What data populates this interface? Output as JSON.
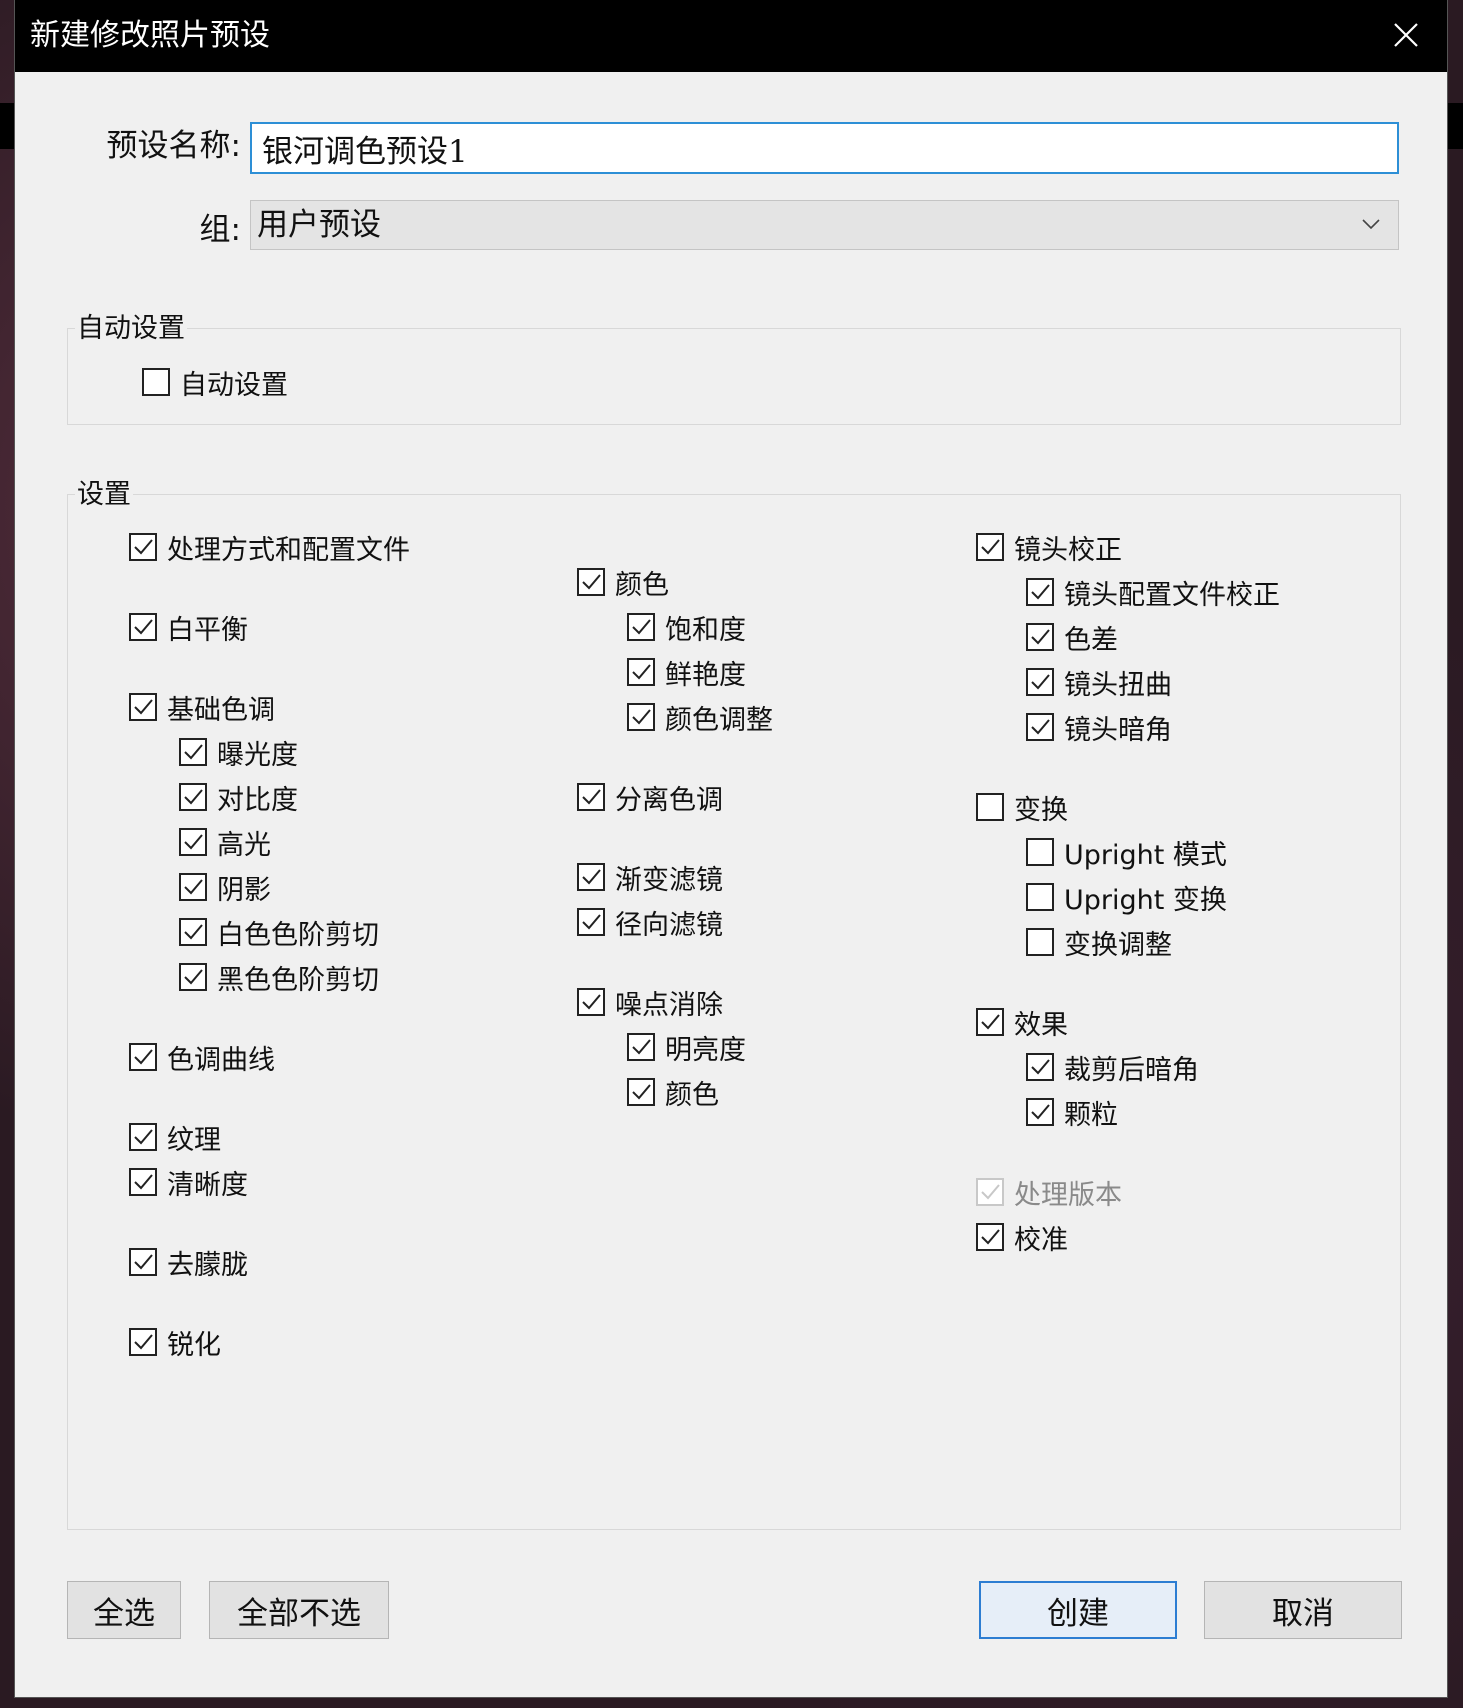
{
  "dialog": {
    "title": "新建修改照片预设",
    "close_icon": "close-icon"
  },
  "form": {
    "name_label": "预设名称:",
    "name_value": "银河调色预设1",
    "group_label": "组:",
    "group_value": "用户预设"
  },
  "auto_section": {
    "title": "自动设置",
    "items": [
      {
        "label": "自动设置",
        "checked": false
      }
    ]
  },
  "settings_section": {
    "title": "设置",
    "col1": [
      {
        "label": "处理方式和配置文件",
        "checked": true
      },
      {
        "label": "白平衡",
        "checked": true
      },
      {
        "label": "基础色调",
        "checked": true
      },
      {
        "label": "曝光度",
        "checked": true
      },
      {
        "label": "对比度",
        "checked": true
      },
      {
        "label": "高光",
        "checked": true
      },
      {
        "label": "阴影",
        "checked": true
      },
      {
        "label": "白色色阶剪切",
        "checked": true
      },
      {
        "label": "黑色色阶剪切",
        "checked": true
      },
      {
        "label": "色调曲线",
        "checked": true
      },
      {
        "label": "纹理",
        "checked": true
      },
      {
        "label": "清晰度",
        "checked": true
      },
      {
        "label": "去朦胧",
        "checked": true
      },
      {
        "label": "锐化",
        "checked": true
      }
    ],
    "col2": [
      {
        "label": "颜色",
        "checked": true
      },
      {
        "label": "饱和度",
        "checked": true
      },
      {
        "label": "鲜艳度",
        "checked": true
      },
      {
        "label": "颜色调整",
        "checked": true
      },
      {
        "label": "分离色调",
        "checked": true
      },
      {
        "label": "渐变滤镜",
        "checked": true
      },
      {
        "label": "径向滤镜",
        "checked": true
      },
      {
        "label": "噪点消除",
        "checked": true
      },
      {
        "label": "明亮度",
        "checked": true
      },
      {
        "label": "颜色",
        "checked": true
      }
    ],
    "col3": [
      {
        "label": "镜头校正",
        "checked": true
      },
      {
        "label": "镜头配置文件校正",
        "checked": true
      },
      {
        "label": "色差",
        "checked": true
      },
      {
        "label": "镜头扭曲",
        "checked": true
      },
      {
        "label": "镜头暗角",
        "checked": true
      },
      {
        "label": "变换",
        "checked": false
      },
      {
        "label": "Upright 模式",
        "checked": false
      },
      {
        "label": "Upright 变换",
        "checked": false
      },
      {
        "label": "变换调整",
        "checked": false
      },
      {
        "label": "效果",
        "checked": true
      },
      {
        "label": "裁剪后暗角",
        "checked": true
      },
      {
        "label": "颗粒",
        "checked": true
      },
      {
        "label": "处理版本",
        "checked": true,
        "disabled": true
      },
      {
        "label": "校准",
        "checked": true
      }
    ]
  },
  "buttons": {
    "select_all": "全选",
    "select_none": "全部不选",
    "create": "创建",
    "cancel": "取消"
  },
  "colors": {
    "accent": "#2d8fd6",
    "titlebar": "#000000",
    "dialog_bg": "#f0f0f0"
  }
}
